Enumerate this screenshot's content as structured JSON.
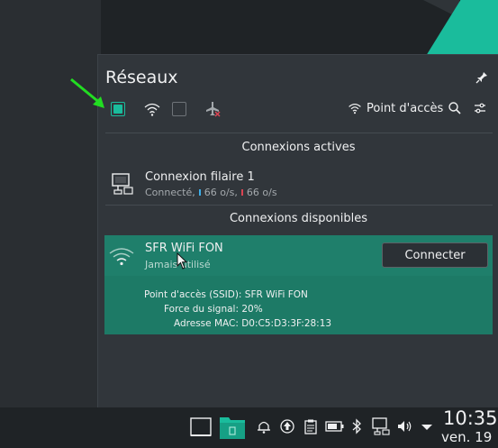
{
  "popup": {
    "title": "Réseaux",
    "hotspot_label": "Point d'accès"
  },
  "active": {
    "header": "Connexions actives",
    "items": [
      {
        "name": "Connexion filaire 1",
        "status": "Connecté,",
        "up": "66 o/s,",
        "down": "66 o/s"
      }
    ]
  },
  "available": {
    "header": "Connexions disponibles",
    "items": [
      {
        "name": "SFR WiFi FON",
        "status": "Jamais utilisé",
        "connect_label": "Connecter",
        "details": [
          {
            "label": "Point d'accès (SSID):",
            "value": "SFR WiFi FON"
          },
          {
            "label": "Force du signal:",
            "value": "20%"
          },
          {
            "label": "Adresse MAC:",
            "value": "D0:C5:D3:3F:28:13"
          }
        ]
      }
    ]
  },
  "clock": {
    "time": "10:35",
    "date": "ven. 19"
  },
  "colors": {
    "accent": "#1abc9c",
    "selected_bg": "#1f7f6b",
    "panel_bg": "#31363b"
  }
}
